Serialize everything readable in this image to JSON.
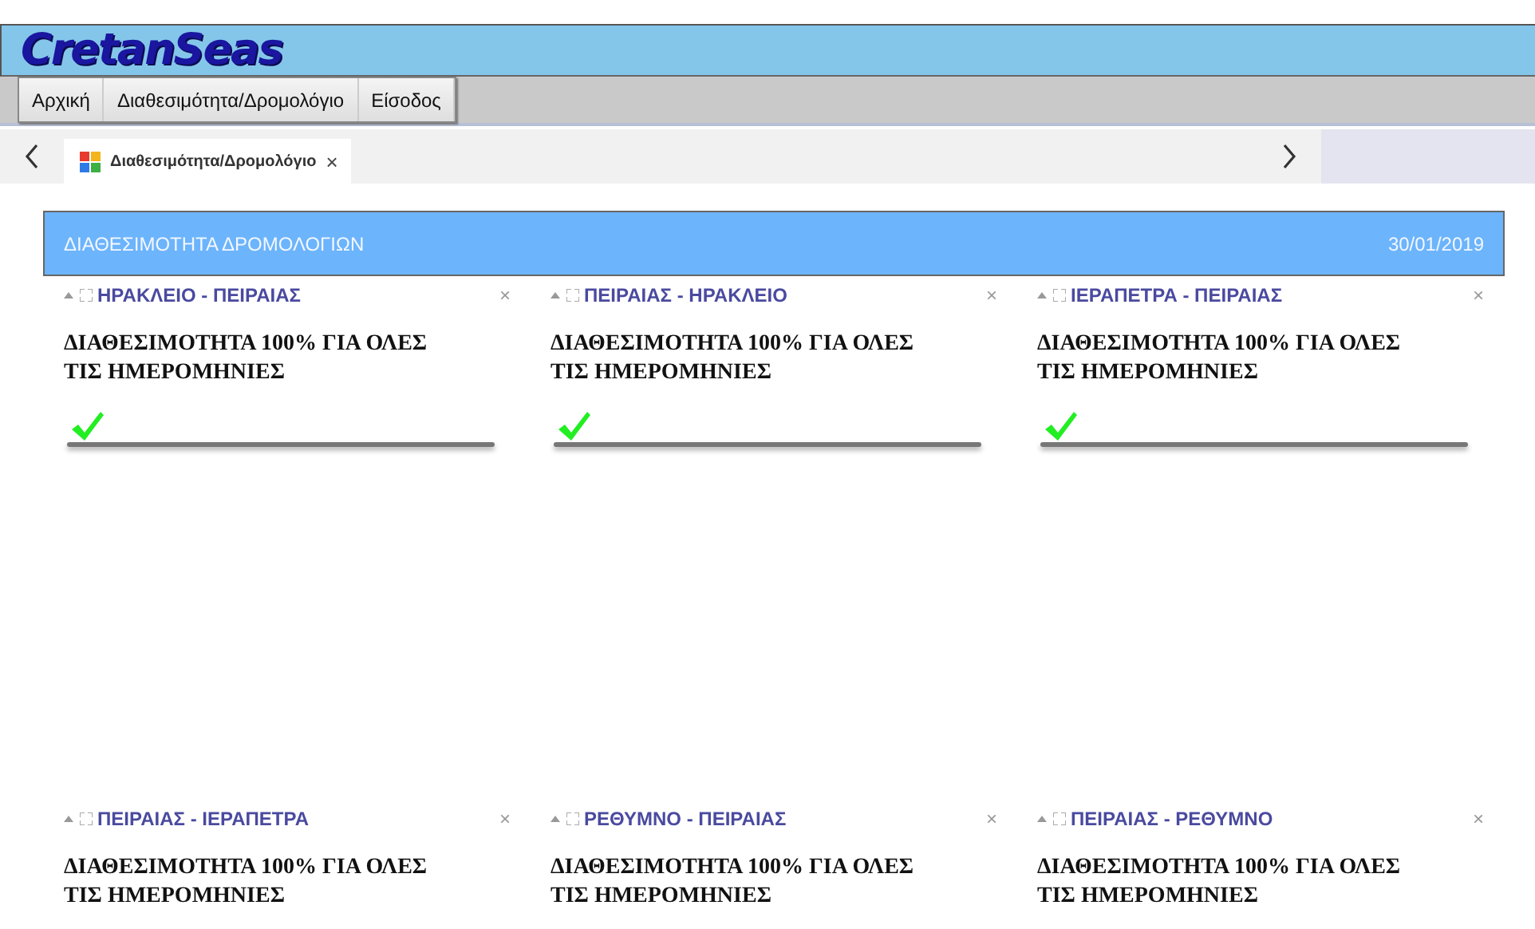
{
  "logo": "CretanSeas",
  "menu": [
    {
      "label": "Αρχική"
    },
    {
      "label": "Διαθεσιμότητα/Δρομολόγιο"
    },
    {
      "label": "Είσοδος"
    }
  ],
  "tabs": [
    {
      "label": "Διαθεσιμότητα/Δρομολόγιο",
      "selected": true,
      "close": "×"
    }
  ],
  "panel": {
    "title": "ΔΙΑΘΕΣΙΜΟΤΗΤΑ ΔΡΟΜΟΛΟΓΙΩΝ",
    "date": "30/01/2019"
  },
  "widgets": [
    {
      "title": "ΗΡΑΚΛΕΙΟ - ΠΕΙΡΑΙΑΣ",
      "close": "×",
      "text": "ΔΙΑΘΕΣΙΜΟΤΗΤΑ 100% ΓΙΑ ΟΛΕΣ ΤΙΣ ΗΜΕΡΟΜΗΝΙΕΣ",
      "available": true
    },
    {
      "title": "ΠΕΙΡΑΙΑΣ - ΗΡΑΚΛΕΙΟ",
      "close": "×",
      "text": "ΔΙΑΘΕΣΙΜΟΤΗΤΑ 100% ΓΙΑ ΟΛΕΣ ΤΙΣ ΗΜΕΡΟΜΗΝΙΕΣ",
      "available": true
    },
    {
      "title": "ΙΕΡΑΠΕΤΡΑ - ΠΕΙΡΑΙΑΣ",
      "close": "×",
      "text": "ΔΙΑΘΕΣΙΜΟΤΗΤΑ 100% ΓΙΑ ΟΛΕΣ ΤΙΣ ΗΜΕΡΟΜΗΝΙΕΣ",
      "available": true
    },
    {
      "title": "ΠΕΙΡΑΙΑΣ - ΙΕΡΑΠΕΤΡΑ",
      "close": "×",
      "text": "ΔΙΑΘΕΣΙΜΟΤΗΤΑ 100% ΓΙΑ ΟΛΕΣ ΤΙΣ ΗΜΕΡΟΜΗΝΙΕΣ"
    },
    {
      "title": "ΡΕΘΥΜΝΟ - ΠΕΙΡΑΙΑΣ",
      "close": "×",
      "text": "ΔΙΑΘΕΣΙΜΟΤΗΤΑ 100% ΓΙΑ ΟΛΕΣ ΤΙΣ ΗΜΕΡΟΜΗΝΙΕΣ"
    },
    {
      "title": "ΠΕΙΡΑΙΑΣ - ΡΕΘΥΜΝΟ",
      "close": "×",
      "text": "ΔΙΑΘΕΣΙΜΟΤΗΤΑ 100% ΓΙΑ ΟΛΕΣ ΤΙΣ ΗΜΕΡΟΜΗΝΙΕΣ"
    }
  ]
}
